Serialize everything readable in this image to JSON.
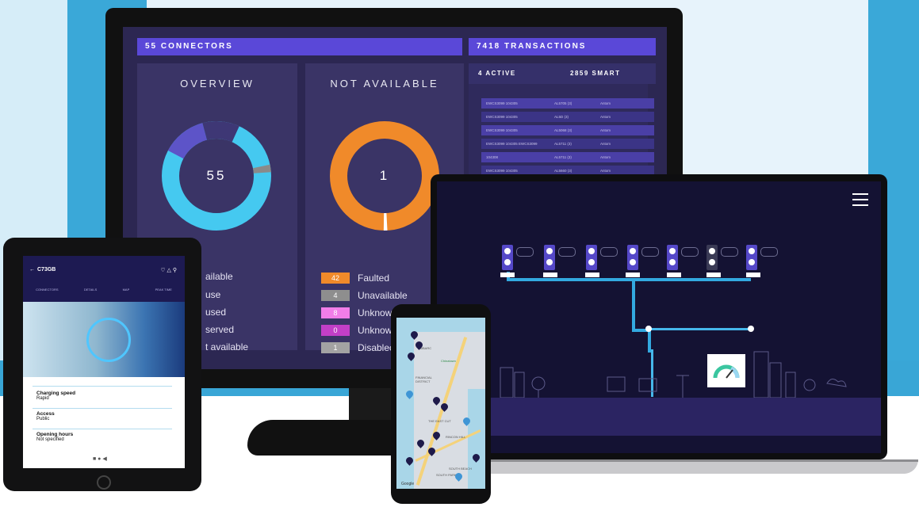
{
  "monitor": {
    "connectors_title": "55 CONNECTORS",
    "transactions_title": "7418 TRANSACTIONS",
    "overview": {
      "heading": "OVERVIEW",
      "center_value": "55",
      "legend": [
        "ailable",
        "use",
        "used",
        "served",
        "t available"
      ]
    },
    "not_available": {
      "heading": "NOT AVAILABLE",
      "center_value": "1",
      "legend": [
        {
          "count": "42",
          "label": "Faulted",
          "color": "#f08a2a"
        },
        {
          "count": "4",
          "label": "Unavailable",
          "color": "#8e8e8e"
        },
        {
          "count": "8",
          "label": "Unknown <48h",
          "color": "#f17ee9"
        },
        {
          "count": "0",
          "label": "Unknow",
          "color": "#c23fc7"
        },
        {
          "count": "1",
          "label": "Disablec",
          "color": "#a3a3a3"
        }
      ]
    },
    "tabs": {
      "active": "4 ACTIVE",
      "smart": "2859 SMART"
    },
    "transactions": [
      [
        "EWCS3099 104305",
        "AL5705 (3)",
        "Antom"
      ],
      [
        "EWCS3099 104305",
        "AL5D (3)",
        "Antom"
      ],
      [
        "EWCS3099 104305",
        "AL5068 (3)",
        "Antom"
      ],
      [
        "EWCS3099 104305 EWCS3099",
        "AL5711 (3)",
        "Antom"
      ],
      [
        "104308",
        "AL5711 (3)",
        "Antom"
      ],
      [
        "EWCS3099 104305",
        "AL5660 (3)",
        "Antom"
      ]
    ],
    "colors": {
      "available": "#45c9f0",
      "in_use": "#5d54c8",
      "reserved": "#8a8a8a",
      "faulted": "#f08a2a"
    }
  },
  "tablet": {
    "station_id": "C73GB",
    "tabs": [
      "CONNECTORS",
      "DETAILS",
      "MAP",
      "PEAK TIME"
    ],
    "fields": [
      {
        "label": "Charging speed",
        "value": "Rapid"
      },
      {
        "label": "Access",
        "value": "Public"
      },
      {
        "label": "Opening hours",
        "value": "Not specified"
      }
    ]
  },
  "phone": {
    "map_labels": [
      "EMBARC",
      "FINANCIAL DISTRICT",
      "Chinatown",
      "THE EAST CUT",
      "RINCON HILL",
      "SOUTH BEACH",
      "SOUTH PARK"
    ],
    "google_mark": "Google",
    "pin_badges": [
      "4",
      "1",
      "3",
      "2"
    ]
  },
  "laptop": {
    "menu_icon": "hamburger-menu-icon"
  }
}
